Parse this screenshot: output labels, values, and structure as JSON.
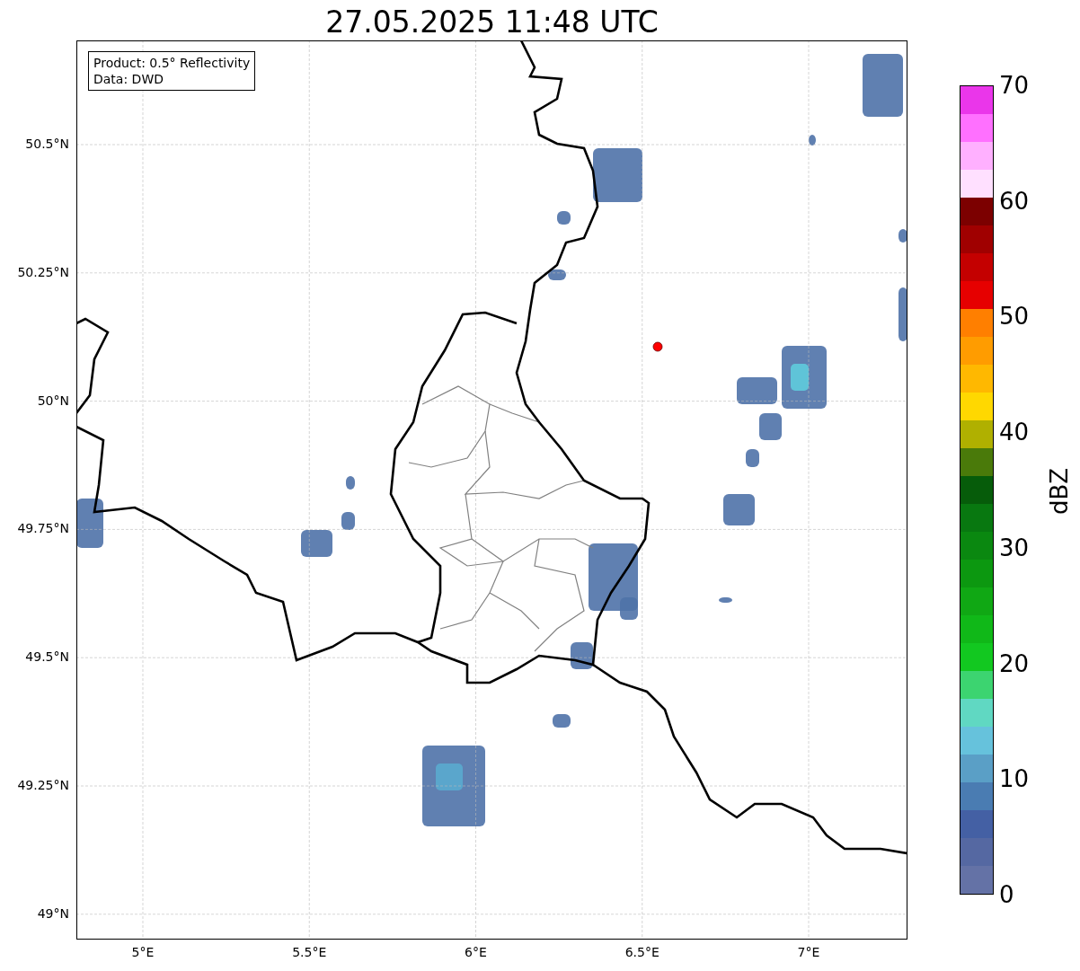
{
  "title": "27.05.2025 11:48 UTC",
  "info_box": {
    "lines": [
      "Product: 0.5° Reflectivity",
      "Data: DWD"
    ]
  },
  "map": {
    "lat_ticks": [
      "50.5°N",
      "50.25°N",
      "50°N",
      "49.75°N",
      "49.5°N",
      "49.25°N",
      "49°N"
    ],
    "lon_ticks": [
      "5°E",
      "5.5°E",
      "6°E",
      "6.5°E",
      "7°E"
    ]
  },
  "colorbar": {
    "label": "dBZ",
    "ticks": [
      "70",
      "60",
      "50",
      "40",
      "30",
      "20",
      "10",
      "0"
    ],
    "segments": [
      {
        "color": "#6472a6"
      },
      {
        "color": "#5568a2"
      },
      {
        "color": "#4460a4"
      },
      {
        "color": "#4a7cb2"
      },
      {
        "color": "#5a9fc6"
      },
      {
        "color": "#66c2dc"
      },
      {
        "color": "#60d8c2"
      },
      {
        "color": "#3cd470"
      },
      {
        "color": "#12c820"
      },
      {
        "color": "#10b818"
      },
      {
        "color": "#10a814"
      },
      {
        "color": "#0c9810"
      },
      {
        "color": "#0a8810"
      },
      {
        "color": "#087810"
      },
      {
        "color": "#065c0a"
      },
      {
        "color": "#4a7a0a"
      },
      {
        "color": "#b0b000"
      },
      {
        "color": "#ffd800"
      },
      {
        "color": "#ffb800"
      },
      {
        "color": "#ff9c00"
      },
      {
        "color": "#ff7f00"
      },
      {
        "color": "#e60000"
      },
      {
        "color": "#c40000"
      },
      {
        "color": "#a00000"
      },
      {
        "color": "#7c0000"
      },
      {
        "color": "#ffe0ff"
      },
      {
        "color": "#ffb0ff"
      },
      {
        "color": "#ff70ff"
      },
      {
        "color": "#ea36ea"
      }
    ]
  }
}
